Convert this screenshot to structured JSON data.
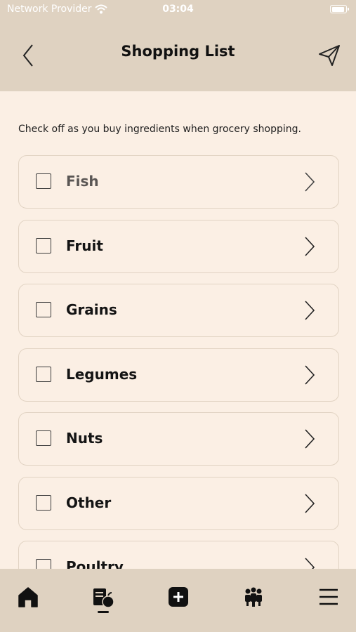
{
  "status_bar": {
    "carrier": "Network Provider",
    "time": "03:04"
  },
  "header": {
    "title": "Shopping List",
    "back_icon": "chevron-left-icon",
    "send_icon": "paper-plane-icon"
  },
  "instructions": "Check off as you buy ingredients when grocery shopping.",
  "categories": [
    {
      "label": "Fish",
      "checked": false
    },
    {
      "label": "Fruit",
      "checked": false
    },
    {
      "label": "Grains",
      "checked": false
    },
    {
      "label": "Legumes",
      "checked": false
    },
    {
      "label": "Nuts",
      "checked": false
    },
    {
      "label": "Other",
      "checked": false
    },
    {
      "label": "Poultry",
      "checked": false
    }
  ],
  "tab_bar": {
    "tabs": [
      {
        "icon": "home-icon"
      },
      {
        "icon": "recipe-list-icon",
        "active": true
      },
      {
        "icon": "add-icon"
      },
      {
        "icon": "community-icon"
      },
      {
        "icon": "menu-icon"
      }
    ]
  },
  "colors": {
    "header_bg": "#dfd2c1",
    "page_bg": "#fbefe4",
    "border": "#e1d3c3"
  }
}
